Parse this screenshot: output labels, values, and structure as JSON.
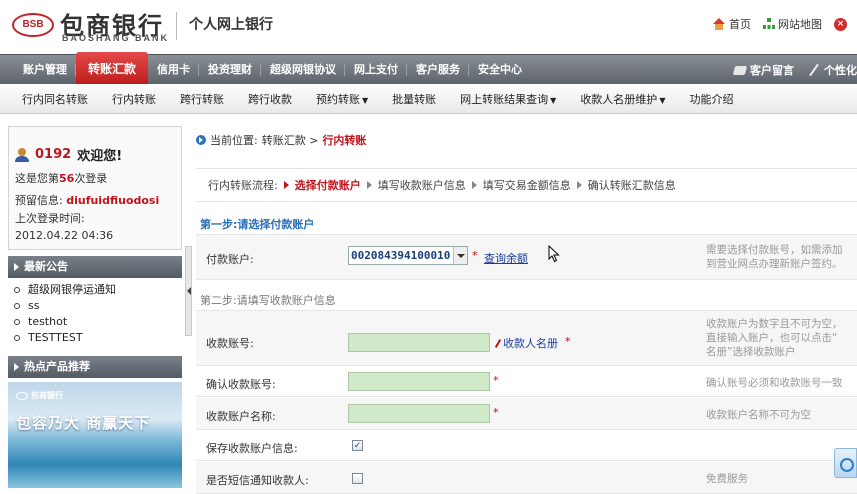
{
  "header": {
    "logo_mark": "BSB",
    "logo_cn": "包商银行",
    "logo_en": "BAOSHANG BANK",
    "site_title": "个人网上银行",
    "links": [
      {
        "label": "首页",
        "icon": "home-icon"
      },
      {
        "label": "网站地图",
        "icon": "sitemap-icon"
      }
    ],
    "close_glyph": "×"
  },
  "mainnav": {
    "items": [
      {
        "label": "账户管理",
        "active": false
      },
      {
        "label": "转账汇款",
        "active": true
      },
      {
        "label": "信用卡",
        "active": false
      },
      {
        "label": "投资理财",
        "active": false
      },
      {
        "label": "超级网银协议",
        "active": false
      },
      {
        "label": "网上支付",
        "active": false
      },
      {
        "label": "客户服务",
        "active": false
      },
      {
        "label": "安全中心",
        "active": false
      }
    ],
    "right": [
      {
        "label": "客户留言",
        "icon": "message-icon"
      },
      {
        "label": "个性化",
        "icon": "pen-icon"
      }
    ]
  },
  "subnav": {
    "items": [
      {
        "label": "行内同名转账",
        "caret": ""
      },
      {
        "label": "行内转账",
        "caret": ""
      },
      {
        "label": "跨行转账",
        "caret": ""
      },
      {
        "label": "跨行收款",
        "caret": ""
      },
      {
        "label": "预约转账",
        "caret": "▼"
      },
      {
        "label": "批量转账",
        "caret": ""
      },
      {
        "label": "网上转账结果查询",
        "caret": "▼"
      },
      {
        "label": "收款人名册维护",
        "caret": "▼"
      },
      {
        "label": "功能介绍",
        "caret": ""
      }
    ]
  },
  "sidebar": {
    "user_id": "0192",
    "welcome": "欢迎您!",
    "login_prefix": "这是您第",
    "login_count": "56",
    "login_suffix": "次登录",
    "reserve_label": "预留信息:",
    "reserve_value": "diufuidfiuodosi",
    "last_login_label": "上次登录时间:",
    "last_login_time": "2012.04.22 04:36",
    "notice_header": "最新公告",
    "notices": [
      "超级网银停运通知",
      "ss",
      "testhot",
      "TESTTEST"
    ],
    "products_header": "热点产品推荐",
    "promo_logo": "包商银行",
    "promo_slogan": "包容乃大  商赢天下"
  },
  "content": {
    "breadcrumb_prefix": "当前位置:",
    "breadcrumb_parent": "转账汇款 >",
    "breadcrumb_current": "行内转账",
    "flow_label": "行内转账流程:",
    "flow_steps": [
      {
        "label": "选择付款账户",
        "active": true
      },
      {
        "label": "填写收款账户信息",
        "active": false
      },
      {
        "label": "填写交易金额信息",
        "active": false
      },
      {
        "label": "确认转账汇款信息",
        "active": false
      }
    ],
    "step1_title": "第一步:请选择付款账户",
    "step2_title": "第二步:请填写收款账户信息",
    "account": {
      "label": "付款账户:",
      "value": "002084394100010",
      "query_link": "查询余额",
      "hint1": "需要选择付款账号，如需添加",
      "hint2": "到营业网点办理新账户签约。"
    },
    "payee": {
      "label": "收款账号:",
      "value": "",
      "book_link": "收款人名册",
      "hint1": "收款账户为数字且不可为空，",
      "hint2": "直接输入账户，也可以点击“",
      "hint3": "名册”选择收款账户"
    },
    "confirm": {
      "label": "确认收款账号:",
      "value": "",
      "hint": "确认账号必须和收款账号一致"
    },
    "payee_name": {
      "label": "收款账户名称:",
      "value": "",
      "hint": "收款账户名称不可为空"
    },
    "save": {
      "label": "保存收款账户信息:",
      "checked": true
    },
    "sms": {
      "label": "是否短信通知收款人:",
      "checked": false,
      "hint": "免费服务"
    },
    "required_mark": "*"
  }
}
